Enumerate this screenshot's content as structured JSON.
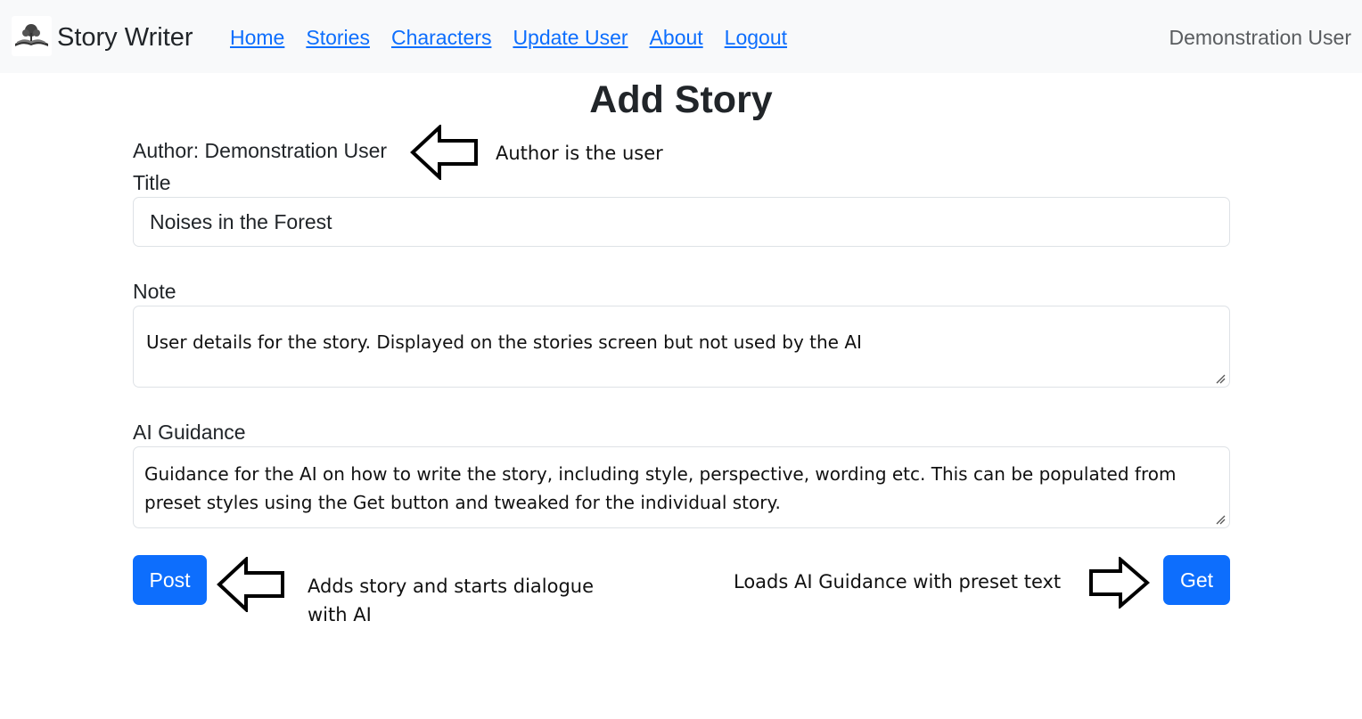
{
  "navbar": {
    "brand": "Story Writer",
    "logo_icon": "open-book-tree-icon",
    "links": [
      "Home",
      "Stories",
      "Characters",
      "Update User",
      "About",
      "Logout"
    ],
    "user": "Demonstration User"
  },
  "page": {
    "title": "Add Story",
    "author_line": "Author: Demonstration User"
  },
  "form": {
    "title_label": "Title",
    "title_value": "Noises in the Forest",
    "note_label": "Note",
    "note_value": "User details for the story. Displayed on the stories screen but not used by the AI",
    "guidance_label": "AI Guidance",
    "guidance_value": "Guidance for the AI on how to write the story, including style, perspective, wording etc. This can be populated from preset styles using the Get button and tweaked for the individual story.",
    "post_label": "Post",
    "get_label": "Get"
  },
  "annotations": {
    "author": "Author is the user",
    "post_line1": "Adds story and starts dialogue",
    "post_line2": "with AI",
    "get": "Loads AI Guidance with preset text"
  },
  "colors": {
    "primary": "#0d6efd",
    "navbar_bg": "#f8f9fa",
    "text": "#212529"
  }
}
